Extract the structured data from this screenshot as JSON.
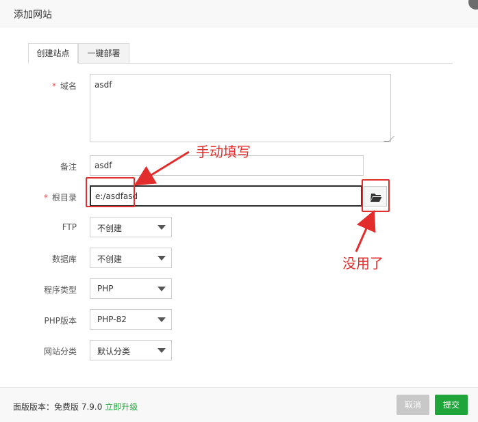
{
  "dialog": {
    "title": "添加网站"
  },
  "tabs": [
    {
      "label": "创建站点",
      "active": true
    },
    {
      "label": "一键部署",
      "active": false
    }
  ],
  "form": {
    "required_mark": "*",
    "domain": {
      "label": "域名",
      "value": "asdf"
    },
    "remark": {
      "label": "备注",
      "value": "asdf"
    },
    "root_dir": {
      "label": "根目录",
      "value": "e:/asdfasd"
    },
    "ftp": {
      "label": "FTP",
      "value": "不创建"
    },
    "database": {
      "label": "数据库",
      "value": "不创建"
    },
    "program_type": {
      "label": "程序类型",
      "value": "PHP"
    },
    "php_version": {
      "label": "PHP版本",
      "value": "PHP-82"
    },
    "site_category": {
      "label": "网站分类",
      "value": "默认分类"
    }
  },
  "footer": {
    "version_text": "面版版本：免费版 7.9.0",
    "upgrade_label": "立即升级",
    "cancel_label": "取消",
    "submit_label": "提交"
  },
  "annotations": {
    "manual_fill": "手动填写",
    "not_working": "没用了",
    "color": "#e32d2d"
  },
  "colors": {
    "accent_green": "#20a53a",
    "disabled_gray": "#c8c8c8"
  }
}
